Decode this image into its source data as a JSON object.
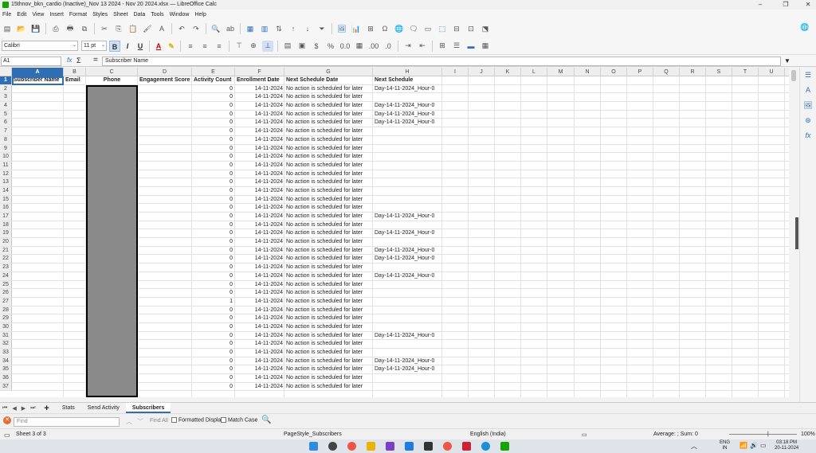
{
  "window": {
    "title": "15thnov_bkn_cardio (Inactive)_Nov 13 2024 - Nov 20 2024.xlsx — LibreOffice Calc"
  },
  "menu": [
    "File",
    "Edit",
    "View",
    "Insert",
    "Format",
    "Styles",
    "Sheet",
    "Data",
    "Tools",
    "Window",
    "Help"
  ],
  "font": {
    "name": "Calibri",
    "size": "11 pt"
  },
  "formula": {
    "cell_ref": "A1",
    "content": "Subscriber Name"
  },
  "columns": [
    "A",
    "B",
    "C",
    "D",
    "E",
    "F",
    "G",
    "H",
    "I",
    "J",
    "K",
    "L",
    "M",
    "N",
    "O",
    "P",
    "Q",
    "R",
    "S",
    "T",
    "U"
  ],
  "headers": [
    "Subscriber Name",
    "Email",
    "Phone",
    "Engagement Score",
    "Activity Count",
    "Enrollment Date",
    "Next Schedule Date",
    "Next Schedule"
  ],
  "rows": [
    {
      "n": "2",
      "e": "0",
      "d": "14-11-2024",
      "g": "No action is scheduled for later",
      "h": "Day-14-11-2024_Hour-0"
    },
    {
      "n": "3",
      "e": "0",
      "d": "14-11-2024",
      "g": "No action is scheduled for later",
      "h": ""
    },
    {
      "n": "4",
      "e": "0",
      "d": "14-11-2024",
      "g": "No action is scheduled for later",
      "h": "Day-14-11-2024_Hour-0"
    },
    {
      "n": "5",
      "e": "0",
      "d": "14-11-2024",
      "g": "No action is scheduled for later",
      "h": "Day-14-11-2024_Hour-0"
    },
    {
      "n": "6",
      "e": "0",
      "d": "14-11-2024",
      "g": "No action is scheduled for later",
      "h": "Day-14-11-2024_Hour-0"
    },
    {
      "n": "7",
      "e": "0",
      "d": "14-11-2024",
      "g": "No action is scheduled for later",
      "h": ""
    },
    {
      "n": "8",
      "e": "0",
      "d": "14-11-2024",
      "g": "No action is scheduled for later",
      "h": ""
    },
    {
      "n": "9",
      "e": "0",
      "d": "14-11-2024",
      "g": "No action is scheduled for later",
      "h": ""
    },
    {
      "n": "10",
      "e": "0",
      "d": "14-11-2024",
      "g": "No action is scheduled for later",
      "h": ""
    },
    {
      "n": "11",
      "e": "0",
      "d": "14-11-2024",
      "g": "No action is scheduled for later",
      "h": ""
    },
    {
      "n": "12",
      "e": "0",
      "d": "14-11-2024",
      "g": "No action is scheduled for later",
      "h": ""
    },
    {
      "n": "13",
      "e": "0",
      "d": "14-11-2024",
      "g": "No action is scheduled for later",
      "h": ""
    },
    {
      "n": "14",
      "e": "0",
      "d": "14-11-2024",
      "g": "No action is scheduled for later",
      "h": ""
    },
    {
      "n": "15",
      "e": "0",
      "d": "14-11-2024",
      "g": "No action is scheduled for later",
      "h": ""
    },
    {
      "n": "16",
      "e": "0",
      "d": "14-11-2024",
      "g": "No action is scheduled for later",
      "h": ""
    },
    {
      "n": "17",
      "e": "0",
      "d": "14-11-2024",
      "g": "No action is scheduled for later",
      "h": "Day-14-11-2024_Hour-0"
    },
    {
      "n": "18",
      "e": "0",
      "d": "14-11-2024",
      "g": "No action is scheduled for later",
      "h": ""
    },
    {
      "n": "19",
      "e": "0",
      "d": "14-11-2024",
      "g": "No action is scheduled for later",
      "h": "Day-14-11-2024_Hour-0"
    },
    {
      "n": "20",
      "e": "0",
      "d": "14-11-2024",
      "g": "No action is scheduled for later",
      "h": ""
    },
    {
      "n": "21",
      "e": "0",
      "d": "14-11-2024",
      "g": "No action is scheduled for later",
      "h": "Day-14-11-2024_Hour-0"
    },
    {
      "n": "22",
      "e": "0",
      "d": "14-11-2024",
      "g": "No action is scheduled for later",
      "h": "Day-14-11-2024_Hour-0"
    },
    {
      "n": "23",
      "e": "0",
      "d": "14-11-2024",
      "g": "No action is scheduled for later",
      "h": ""
    },
    {
      "n": "24",
      "e": "0",
      "d": "14-11-2024",
      "g": "No action is scheduled for later",
      "h": "Day-14-11-2024_Hour-0"
    },
    {
      "n": "25",
      "e": "0",
      "d": "14-11-2024",
      "g": "No action is scheduled for later",
      "h": ""
    },
    {
      "n": "26",
      "e": "0",
      "d": "14-11-2024",
      "g": "No action is scheduled for later",
      "h": ""
    },
    {
      "n": "27",
      "e": "1",
      "d": "14-11-2024",
      "g": "No action is scheduled for later",
      "h": ""
    },
    {
      "n": "28",
      "e": "0",
      "d": "14-11-2024",
      "g": "No action is scheduled for later",
      "h": ""
    },
    {
      "n": "29",
      "e": "0",
      "d": "14-11-2024",
      "g": "No action is scheduled for later",
      "h": ""
    },
    {
      "n": "30",
      "e": "0",
      "d": "14-11-2024",
      "g": "No action is scheduled for later",
      "h": ""
    },
    {
      "n": "31",
      "e": "0",
      "d": "14-11-2024",
      "g": "No action is scheduled for later",
      "h": "Day-14-11-2024_Hour-0"
    },
    {
      "n": "32",
      "e": "0",
      "d": "14-11-2024",
      "g": "No action is scheduled for later",
      "h": ""
    },
    {
      "n": "33",
      "e": "0",
      "d": "14-11-2024",
      "g": "No action is scheduled for later",
      "h": ""
    },
    {
      "n": "34",
      "e": "0",
      "d": "14-11-2024",
      "g": "No action is scheduled for later",
      "h": "Day-14-11-2024_Hour-0"
    },
    {
      "n": "35",
      "e": "0",
      "d": "14-11-2024",
      "g": "No action is scheduled for later",
      "h": "Day-14-11-2024_Hour-0"
    },
    {
      "n": "36",
      "e": "0",
      "d": "14-11-2024",
      "g": "No action is scheduled for later",
      "h": ""
    },
    {
      "n": "37",
      "e": "0",
      "d": "14-11-2024",
      "g": "No action is scheduled for later",
      "h": ""
    }
  ],
  "tabs": [
    "Stats",
    "Send Activity",
    "Subscribers"
  ],
  "find": {
    "placeholder": "Find",
    "find_all": "Find All",
    "formatted_display": "Formatted Display",
    "match_case": "Match Case"
  },
  "status": {
    "sheet": "Sheet 3 of 3",
    "page_style": "PageStyle_Subscribers",
    "language": "English (India)",
    "summary": "Average: ; Sum: 0",
    "zoom": "100%"
  },
  "taskbar": {
    "lang": "ENG",
    "lang2": "IN",
    "time": "03:18 PM",
    "date": "20-11-2024"
  },
  "colors": {
    "accent": "#2f6db5",
    "brand": "#18a303"
  }
}
